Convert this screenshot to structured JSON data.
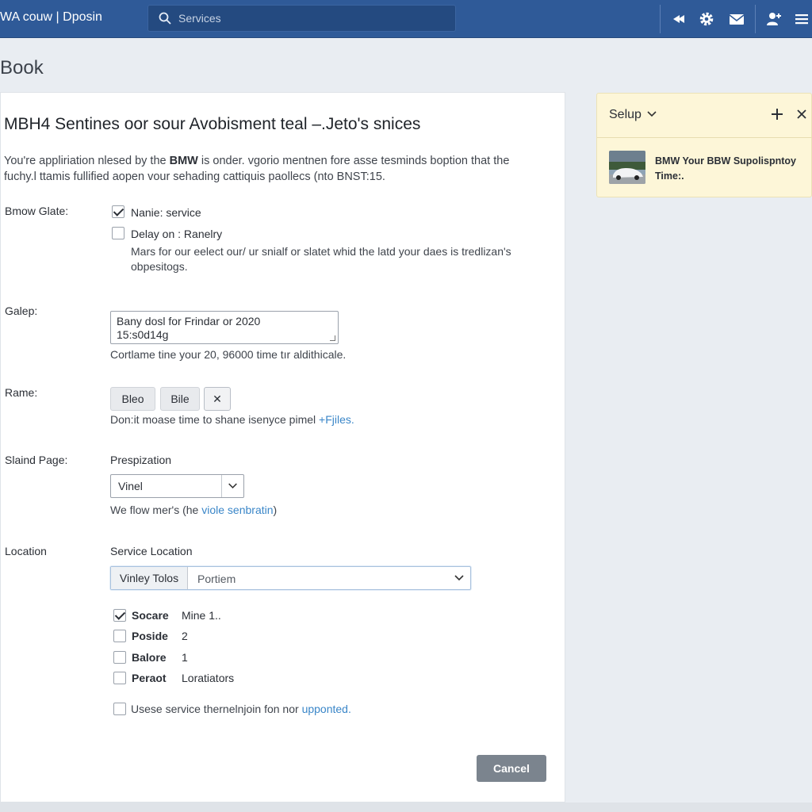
{
  "header": {
    "app_title": "WA couw | Dposin",
    "search_placeholder": "Services",
    "icons": [
      "back-icon",
      "gear-icon",
      "mail-icon",
      "user-add-icon",
      "menu-icon"
    ]
  },
  "page": {
    "heading": "Book"
  },
  "form": {
    "title": "MBH4 Sentines oor sour Avobisment teal –.Jeto's snices",
    "intro_prefix": "You're appliriation nlesed by the ",
    "intro_brand": "BMW",
    "intro_suffix": " is onder. vgorio mentnen fore asse tesminds boption that the fuchy.l ttamis fullified aopen vour sehading cattiquis paollecs (nto BNST:15.",
    "row1": {
      "label": "Bmow Glate:",
      "options": [
        {
          "label": "Nanie: service",
          "checked": true
        },
        {
          "label": "Delay on : Ranelry",
          "checked": false
        }
      ],
      "help": "Mars for our eelect our/ ur snialf or slatet whid the latd your daes is tredlizan's obpesitogs."
    },
    "row2": {
      "label": "Galep:",
      "textarea_line1": "Bany dosl for Frindar or 2020",
      "textarea_line2": "15:s0d14g",
      "help": "Cortlame tine your 20, 96000 time tır aldithicale."
    },
    "row3": {
      "label": "Rame:",
      "buttons": [
        "Bleo",
        "Bile",
        "✕"
      ],
      "help_prefix": "Don:it moase time to shane isenyce pimel ",
      "help_link": "+Fjiles."
    },
    "row4": {
      "label": "Slaind Page:",
      "field_label": "Prespization",
      "select_value": "Vinel",
      "help_prefix": "We flow mer's (he ",
      "help_link": "viole senbratin",
      "help_suffix": ")"
    },
    "row5": {
      "label": "Location",
      "field_label": "Service Location",
      "combo_segment": "Vinley Tolos",
      "combo_value": "Portiem",
      "options": [
        {
          "label": "Socare",
          "value": "Mine 1..",
          "checked": true
        },
        {
          "label": "Poside",
          "value": "2",
          "checked": false
        },
        {
          "label": "Balore",
          "value": "1",
          "checked": false
        },
        {
          "label": "Peraot",
          "value": "Loratiators",
          "checked": false
        }
      ],
      "consent_prefix": "Usese service thernelnjoin fon nor ",
      "consent_link": "upponted."
    },
    "cancel_label": "Cancel"
  },
  "side_panel": {
    "title": "Selup",
    "item_text": "BMW Your BBW Supolispntoy Time:."
  },
  "colors": {
    "topbar": "#2f5a98",
    "link": "#3a86c8",
    "cancel_button": "#7b848e",
    "side_panel": "#fdf6d8"
  }
}
